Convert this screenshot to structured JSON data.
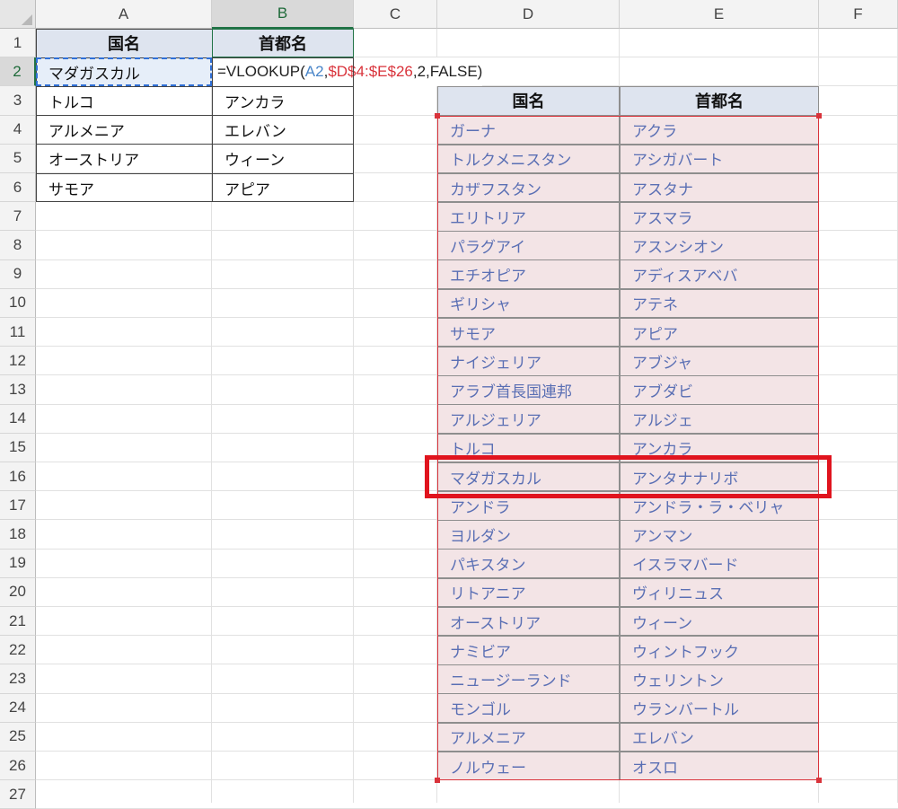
{
  "columns": [
    "A",
    "B",
    "C",
    "D",
    "E",
    "F"
  ],
  "rows": [
    "1",
    "2",
    "3",
    "4",
    "5",
    "6",
    "7",
    "8",
    "9",
    "10",
    "11",
    "12",
    "13",
    "14",
    "15",
    "16",
    "17",
    "18",
    "19",
    "20",
    "21",
    "22",
    "23",
    "24",
    "25",
    "26",
    "27"
  ],
  "left_table": {
    "header": [
      "国名",
      "首都名"
    ],
    "active_cell": "マダガスカル",
    "formula": {
      "prefix": "=VLOOKUP(",
      "arg1": "A2",
      "sep1": ",",
      "arg2": "$D$4:$E$26",
      "rest": ",2,FALSE)"
    },
    "rows": [
      [
        "トルコ",
        "アンカラ"
      ],
      [
        "アルメニア",
        "エレバン"
      ],
      [
        "オーストリア",
        "ウィーン"
      ],
      [
        "サモア",
        "アピア"
      ]
    ]
  },
  "right_table": {
    "header": [
      "国名",
      "首都名"
    ],
    "rows": [
      [
        "ガーナ",
        "アクラ"
      ],
      [
        "トルクメニスタン",
        "アシガバート"
      ],
      [
        "カザフスタン",
        "アスタナ"
      ],
      [
        "エリトリア",
        "アスマラ"
      ],
      [
        "パラグアイ",
        "アスンシオン"
      ],
      [
        "エチオピア",
        "アディスアベバ"
      ],
      [
        "ギリシャ",
        "アテネ"
      ],
      [
        "サモア",
        "アピア"
      ],
      [
        "ナイジェリア",
        "アブジャ"
      ],
      [
        "アラブ首長国連邦",
        "アブダビ"
      ],
      [
        "アルジェリア",
        "アルジェ"
      ],
      [
        "トルコ",
        "アンカラ"
      ],
      [
        "マダガスカル",
        "アンタナナリボ"
      ],
      [
        "アンドラ",
        "アンドラ・ラ・ベリャ"
      ],
      [
        "ヨルダン",
        "アンマン"
      ],
      [
        "パキスタン",
        "イスラマバード"
      ],
      [
        "リトアニア",
        "ヴィリニュス"
      ],
      [
        "オーストリア",
        "ウィーン"
      ],
      [
        "ナミビア",
        "ウィントフック"
      ],
      [
        "ニュージーランド",
        "ウェリントン"
      ],
      [
        "モンゴル",
        "ウランバートル"
      ],
      [
        "アルメニア",
        "エレバン"
      ],
      [
        "ノルウェー",
        "オスロ"
      ]
    ],
    "highlighted_row": 13
  },
  "colors": {
    "header_fill": "#dee4ef",
    "lookup_fill": "#f3e4e6",
    "lookup_text": "#5a6fb4",
    "range_border": "#d9333b",
    "highlight_box": "#e0141e",
    "active_cell_border": "#2f6fd6",
    "formula_ref_blue": "#4a86c9",
    "selected_header": "#217346"
  }
}
